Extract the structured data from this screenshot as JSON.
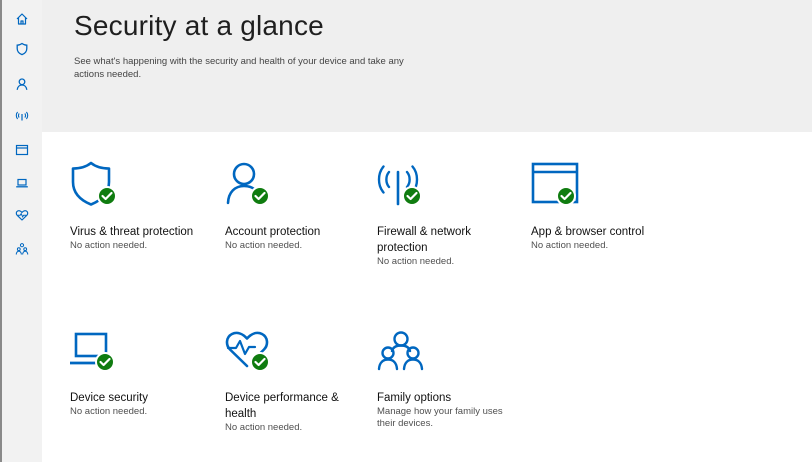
{
  "header": {
    "title": "Security at a glance",
    "subtitle": "See what's happening with the security and health of your device and take any actions needed."
  },
  "sidebar": {
    "items": [
      {
        "icon": "home-icon"
      },
      {
        "icon": "shield-icon"
      },
      {
        "icon": "person-icon"
      },
      {
        "icon": "wifi-icon"
      },
      {
        "icon": "browser-icon"
      },
      {
        "icon": "laptop-icon"
      },
      {
        "icon": "heart-icon"
      },
      {
        "icon": "family-icon"
      }
    ]
  },
  "tiles": [
    {
      "title": "Virus & threat protection",
      "status": "No action needed.",
      "icon": "shield-check-icon"
    },
    {
      "title": "Account protection",
      "status": "No action needed.",
      "icon": "person-check-icon"
    },
    {
      "title": "Firewall & network protection",
      "status": "No action needed.",
      "icon": "wifi-check-icon"
    },
    {
      "title": "App & browser control",
      "status": "No action needed.",
      "icon": "browser-check-icon"
    },
    {
      "title": "Device security",
      "status": "No action needed.",
      "icon": "laptop-check-icon"
    },
    {
      "title": "Device performance & health",
      "status": "No action needed.",
      "icon": "heart-check-icon"
    },
    {
      "title": "Family options",
      "status": "Manage how your family uses their devices.",
      "icon": "family-icon"
    }
  ],
  "colors": {
    "accent": "#0067c0",
    "ok": "#107c10",
    "header_bg": "#efefef",
    "sidebar_bg": "#f2f2f2"
  }
}
